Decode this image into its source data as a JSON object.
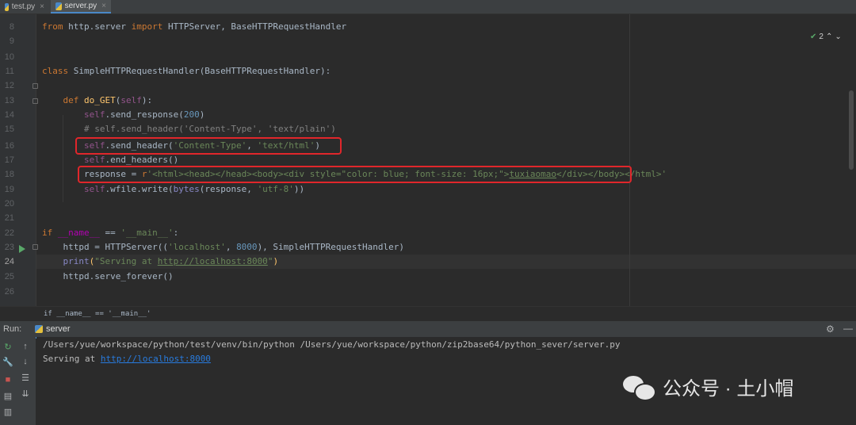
{
  "tabs": [
    {
      "label": "test.py",
      "close": "×",
      "active": false
    },
    {
      "label": "server.py",
      "close": "×",
      "active": true
    }
  ],
  "inspection": {
    "count": "2",
    "icon": "check-icon"
  },
  "editor": {
    "line_numbers": [
      "8",
      "9",
      "10",
      "11",
      "12",
      "13",
      "14",
      "15",
      "16",
      "17",
      "18",
      "19",
      "20",
      "21",
      "22",
      "23",
      "24",
      "25",
      "26"
    ],
    "current_line": "24",
    "code": {
      "l8": {
        "kw": "from",
        "mod": " http.server ",
        "kw2": "import",
        "rest": " HTTPServer, BaseHTTPRequestHandler"
      },
      "l11": {
        "kw": "class",
        "name": " SimpleHTTPRequestHandler(BaseHTTPRequestHandler):"
      },
      "l13": {
        "indent": "    ",
        "kw": "def",
        "sp": " ",
        "fn": "do_GET",
        "open": "(",
        "self": "self",
        "close": "):"
      },
      "l14": {
        "indent": "        ",
        "self": "self",
        "call": ".send_response(",
        "num": "200",
        "close": ")"
      },
      "l15": {
        "indent": "        ",
        "comment": "# self.send_header('Content-Type', 'text/plain')"
      },
      "l16": {
        "indent": "        ",
        "self": "self",
        "call": ".send_header(",
        "s1": "'Content-Type'",
        "sep": ", ",
        "s2": "'text/html'",
        "close": ")"
      },
      "l17": {
        "indent": "        ",
        "self": "self",
        "call": ".end_headers()"
      },
      "l18": {
        "indent": "        ",
        "var": "response = ",
        "prefix": "r",
        "s_open": "'<html><head></head><body><div style=\"color: blue; font-size: 16px;\">",
        "s_link": "tuxiaomao",
        "s_close": "</div></body></html>'"
      },
      "l19": {
        "indent": "        ",
        "self": "self",
        "call": ".wfile.write(",
        "bi": "bytes",
        "mid": "(response, ",
        "str": "'utf-8'",
        "close": "))"
      },
      "l22": {
        "kw": "if",
        "sp": " ",
        "dunder": "__name__",
        "eq": " == ",
        "str": "'__main__'",
        "colon": ":"
      },
      "l23": {
        "indent": "    ",
        "pre": "httpd = HTTPServer((",
        "s1": "'localhost'",
        "sep": ", ",
        "num": "8000",
        "post": "), SimpleHTTPRequestHandler)"
      },
      "l24": {
        "indent": "    ",
        "bi": "print",
        "open": "(",
        "s_pre": "\"Serving at ",
        "s_link": "http://localhost:8000",
        "s_end": "\"",
        "close": ")"
      },
      "l25": {
        "indent": "    ",
        "rest": "httpd.serve_forever()"
      }
    }
  },
  "breadcrumb": "if __name__ == '__main__'",
  "run": {
    "label": "Run:",
    "tab": "server",
    "console_line1": "/Users/yue/workspace/python/test/venv/bin/python /Users/yue/workspace/python/zip2base64/python_sever/server.py",
    "console_prefix": "Serving at ",
    "console_link": "http://localhost:8000"
  },
  "watermark": "公众号 · 土小帽",
  "colors": {
    "highlight_box": "#e0262b",
    "accent": "#4a88c7",
    "run_green": "#59a869"
  }
}
